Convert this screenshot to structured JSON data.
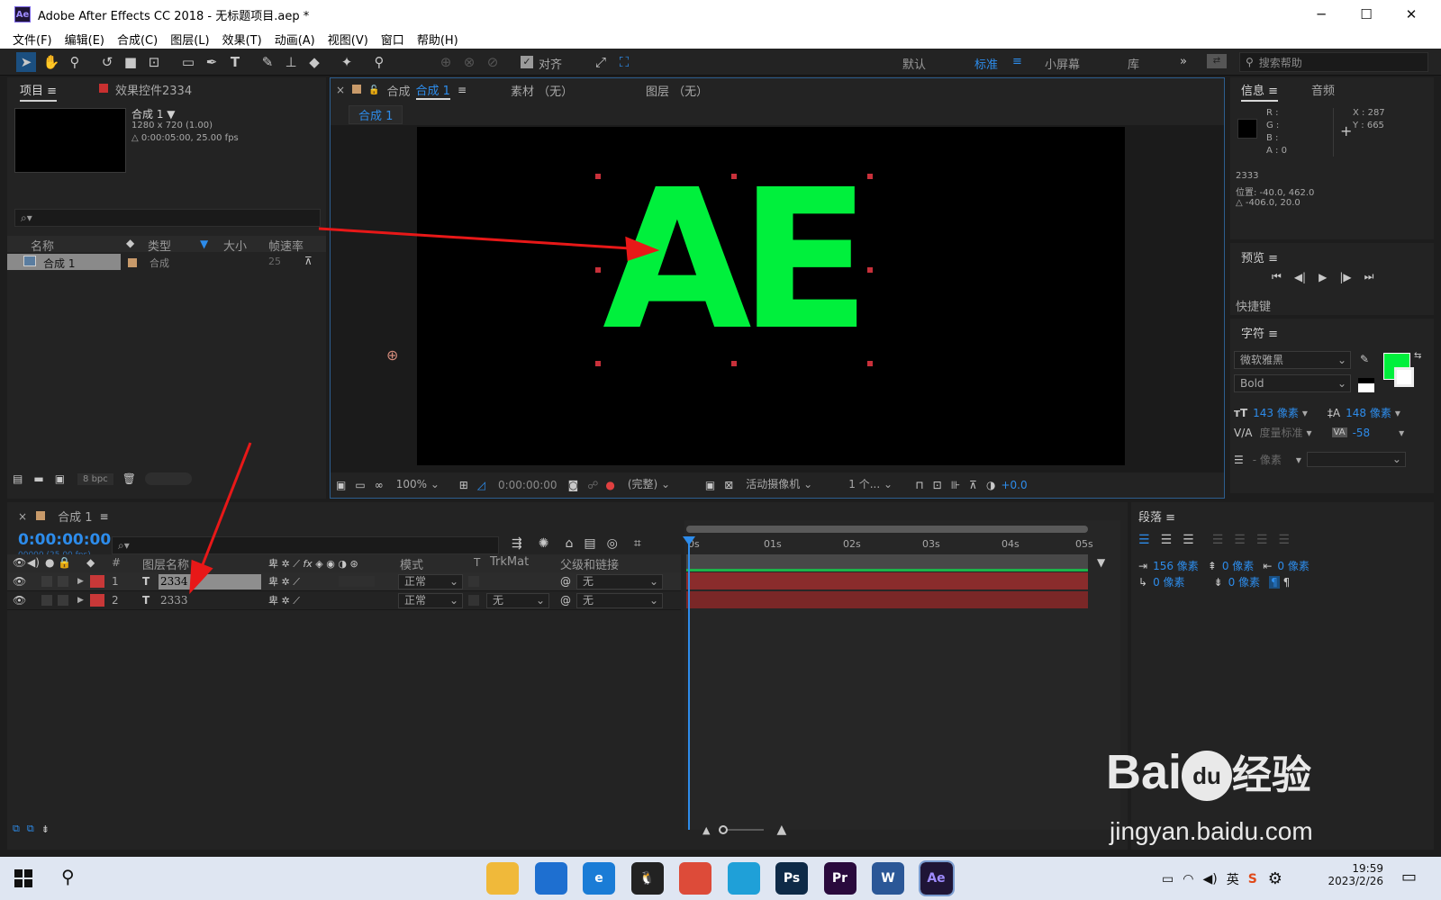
{
  "window": {
    "app_icon": "Ae",
    "title": "Adobe After Effects CC 2018 - 无标题项目.aep *",
    "minimize": "─",
    "maximize": "☐",
    "close": "✕"
  },
  "menu": [
    "文件(F)",
    "编辑(E)",
    "合成(C)",
    "图层(L)",
    "效果(T)",
    "动画(A)",
    "视图(V)",
    "窗口",
    "帮助(H)"
  ],
  "toolbar": {
    "snap_label": "对齐",
    "workspaces": [
      "默认",
      "标准",
      "小屏幕",
      "库"
    ],
    "active_workspace": "标准",
    "overflow": "»",
    "search_placeholder": "搜索帮助"
  },
  "project_panel": {
    "tab_project": "项目",
    "tab_effects": "效果控件2334",
    "comp_name": "合成 1",
    "comp_res": "1280 x 720 (1.00)",
    "comp_duration": "△ 0:00:05:00, 25.00 fps",
    "search_icon": "⌕▾",
    "columns": [
      "名称",
      "类型",
      "大小",
      "帧速率"
    ],
    "item": {
      "name": "合成 1",
      "type": "合成",
      "fps": "25"
    },
    "bpc": "8 bpc"
  },
  "comp_panel": {
    "tab_comp_prefix": "合成",
    "tab_comp_name": "合成 1",
    "tab_footage": "素材 （无）",
    "tab_layer": "图层 （无）",
    "comp_tab_label": "合成 1",
    "canvas_text": "AE",
    "canvas_text_color": "#00f03c",
    "zoom": "100%",
    "timecode": "0:00:00:00",
    "quality": "(完整)",
    "camera": "活动摄像机",
    "views": "1 个...",
    "exposure": "+0.0"
  },
  "info_panel": {
    "tab_info": "信息",
    "tab_audio": "音频",
    "r": "R :",
    "g": "G :",
    "b": "B :",
    "a": "A : 0",
    "x": "X : 287",
    "y": "Y : 665",
    "layer_name": "2333",
    "position": "位置: -40.0, 462.0",
    "delta": "△ -406.0, 20.0"
  },
  "preview_panel": {
    "title": "预览",
    "shortcuts": "快捷键"
  },
  "character_panel": {
    "title": "字符",
    "font": "微软雅黑",
    "style": "Bold",
    "fill_color": "#00f03c",
    "size": "143 像素",
    "leading": "148 像素",
    "kerning": "度量标准",
    "tracking": "-58",
    "stroke_width": "- 像素"
  },
  "paragraph_panel": {
    "title": "段落",
    "indent_left": "156 像素",
    "indent_first": "0 像素",
    "space_before": "0 像素",
    "indent_right": "0 像素",
    "space_after": "0 像素"
  },
  "timeline": {
    "tab": "合成 1",
    "timecode": "0:00:00:00",
    "frame_info": "00000 (25.00 fps)",
    "columns": {
      "num": "#",
      "layer_name": "图层名称",
      "mode": "模式",
      "t": "T",
      "trkmat": "TrkMat",
      "parent": "父级和链接",
      "fx": "fx"
    },
    "ruler": [
      "0s",
      "01s",
      "02s",
      "03s",
      "04s",
      "05s"
    ],
    "layers": [
      {
        "num": "1",
        "type": "T",
        "name": "2334",
        "mode": "正常",
        "trkmat": "",
        "parent": "无",
        "color": "#c83838"
      },
      {
        "num": "2",
        "type": "T",
        "name": "2333",
        "mode": "正常",
        "trkmat": "无",
        "parent": "无",
        "color": "#c83838"
      }
    ]
  },
  "watermark": {
    "brand": "Bai",
    "du": "du",
    "suffix": "经验",
    "url": "jingyan.baidu.com"
  },
  "taskbar": {
    "apps": [
      {
        "name": "file-explorer",
        "label": "",
        "color": "#f0b93a"
      },
      {
        "name": "search-app",
        "label": "",
        "color": "#1e6fd0"
      },
      {
        "name": "edge-legacy",
        "label": "e",
        "color": "#1a7cd6"
      },
      {
        "name": "qq",
        "label": "🐧",
        "color": "#222222"
      },
      {
        "name": "chrome",
        "label": "",
        "color": "#dd4b39"
      },
      {
        "name": "edge",
        "label": "",
        "color": "#1fa0d8"
      },
      {
        "name": "photoshop",
        "label": "Ps",
        "color": "#0e2a47"
      },
      {
        "name": "premiere",
        "label": "Pr",
        "color": "#2a0a3d"
      },
      {
        "name": "word",
        "label": "W",
        "color": "#2b5797"
      },
      {
        "name": "after-effects",
        "label": "Ae",
        "color": "#1f1536"
      }
    ],
    "lang": "英",
    "time": "19:59",
    "date": "2023/2/26"
  }
}
